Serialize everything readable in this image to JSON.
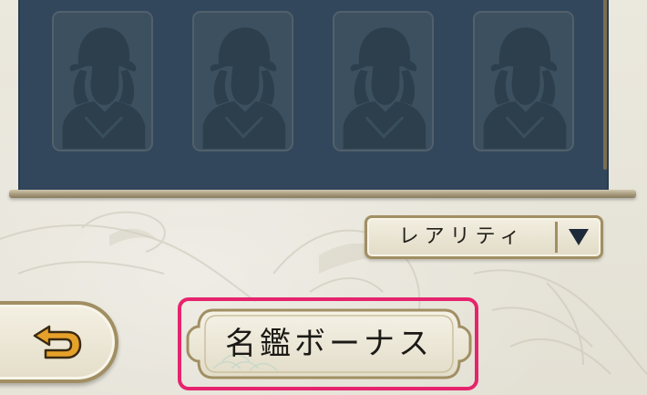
{
  "collection_panel": {
    "cards": [
      {
        "state": "locked-silhouette"
      },
      {
        "state": "locked-silhouette"
      },
      {
        "state": "locked-silhouette"
      },
      {
        "state": "locked-silhouette"
      }
    ]
  },
  "sort_dropdown": {
    "label": "レアリティ",
    "arrow_icon": "triangle-down-icon"
  },
  "back_button": {
    "icon": "return-arrow-icon"
  },
  "bonus_button": {
    "label": "名鑑ボーナス",
    "highlighted": true,
    "highlight_color": "#e6246d"
  },
  "colors": {
    "panel": "#32475b",
    "accent_gold": "#a18f63",
    "icon_orange": "#e6a12a"
  }
}
